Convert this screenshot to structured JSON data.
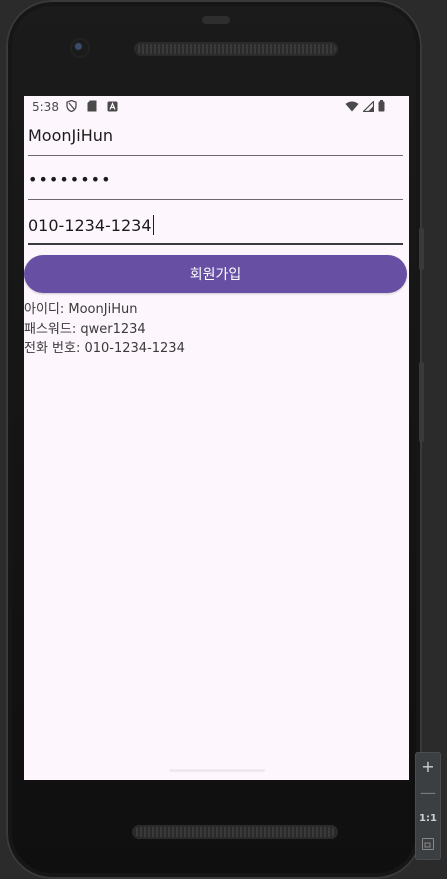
{
  "status_bar": {
    "time": "5:38",
    "left_icons": [
      "shield-icon",
      "sd-card-icon",
      "a-badge-icon"
    ],
    "right_icons": [
      "wifi-icon",
      "signal-icon",
      "battery-icon"
    ]
  },
  "form": {
    "username_value": "MoonJiHun",
    "password_value": "••••••••",
    "phone_value": "010-1234-1234",
    "signup_button_label": "회원가입"
  },
  "results": {
    "id_line": "아이디: MoonJiHun",
    "password_line": "패스워드: qwer1234",
    "phone_line": "전화 번호: 010-1234-1234"
  },
  "emulator_tools": {
    "zoom_in": "+",
    "zoom_out": "—",
    "one_to_one": "1:1"
  },
  "colors": {
    "button": "#6750a4",
    "screen_bg": "#fdf7fd",
    "text": "#1b1b1b"
  }
}
